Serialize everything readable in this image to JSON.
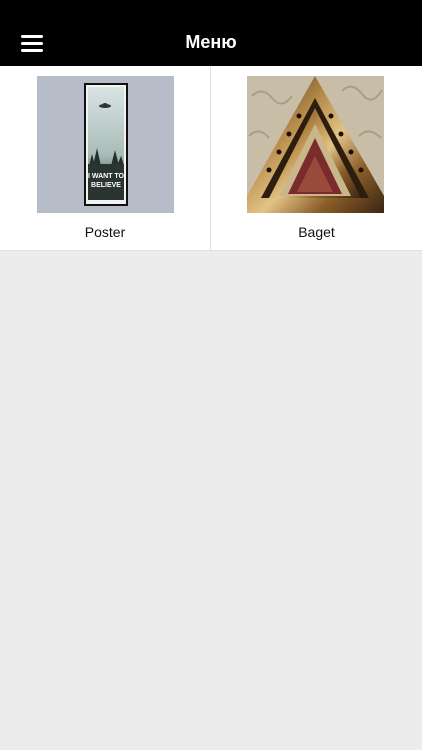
{
  "header": {
    "title": "Меню",
    "menu_icon": "hamburger-menu-icon",
    "background": "#000000"
  },
  "grid": {
    "items": [
      {
        "label": "Poster",
        "image_text": [
          "I WANT TO",
          "BELIEVE"
        ]
      },
      {
        "label": "Baget"
      }
    ]
  },
  "colors": {
    "page_background": "#ececec",
    "card_background": "#ffffff"
  }
}
